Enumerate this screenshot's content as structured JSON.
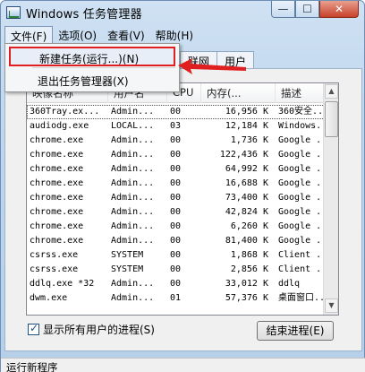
{
  "window": {
    "title": "Windows 任务管理器",
    "min_symbol": "—",
    "max_symbol": "☐",
    "close_symbol": "✕"
  },
  "menubar": {
    "items": [
      "文件(F)",
      "选项(O)",
      "查看(V)",
      "帮助(H)"
    ]
  },
  "file_menu": {
    "items": [
      "新建任务(运行...)(N)",
      "退出任务管理器(X)"
    ]
  },
  "tabs": [
    "联网",
    "用户"
  ],
  "table": {
    "headers": [
      "映像名称",
      "用户名",
      "CPU",
      "内存(...",
      "描述"
    ],
    "rows": [
      [
        "360Tray.ex...",
        "Admin...",
        "00",
        "16,956 K",
        "360安全..."
      ],
      [
        "audiodg.exe",
        "LOCAL...",
        "03",
        "12,184 K",
        "Windows..."
      ],
      [
        "chrome.exe",
        "Admin...",
        "00",
        "1,736 K",
        "Google ..."
      ],
      [
        "chrome.exe",
        "Admin...",
        "00",
        "122,436 K",
        "Google ..."
      ],
      [
        "chrome.exe",
        "Admin...",
        "00",
        "64,992 K",
        "Google ..."
      ],
      [
        "chrome.exe",
        "Admin...",
        "00",
        "16,688 K",
        "Google ..."
      ],
      [
        "chrome.exe",
        "Admin...",
        "00",
        "73,400 K",
        "Google ..."
      ],
      [
        "chrome.exe",
        "Admin...",
        "00",
        "42,824 K",
        "Google ..."
      ],
      [
        "chrome.exe",
        "Admin...",
        "00",
        "6,260 K",
        "Google ..."
      ],
      [
        "chrome.exe",
        "Admin...",
        "00",
        "81,400 K",
        "Google ..."
      ],
      [
        "csrss.exe",
        "SYSTEM",
        "00",
        "1,868 K",
        "Client ..."
      ],
      [
        "csrss.exe",
        "SYSTEM",
        "00",
        "2,856 K",
        "Client ..."
      ],
      [
        "ddlq.exe *32",
        "Admin...",
        "00",
        "33,012 K",
        "ddlq"
      ],
      [
        "dwm.exe",
        "Admin...",
        "01",
        "57,376 K",
        "桌面窗口..."
      ]
    ]
  },
  "show_all_label": "显示所有用户的进程(S)",
  "end_process_label": "结束进程(E)",
  "status_text": "运行新程序",
  "scroll": {
    "up": "▲",
    "down": "▼"
  },
  "colors": {
    "highlight_border": "#e02020",
    "arrow": "#e02020"
  }
}
